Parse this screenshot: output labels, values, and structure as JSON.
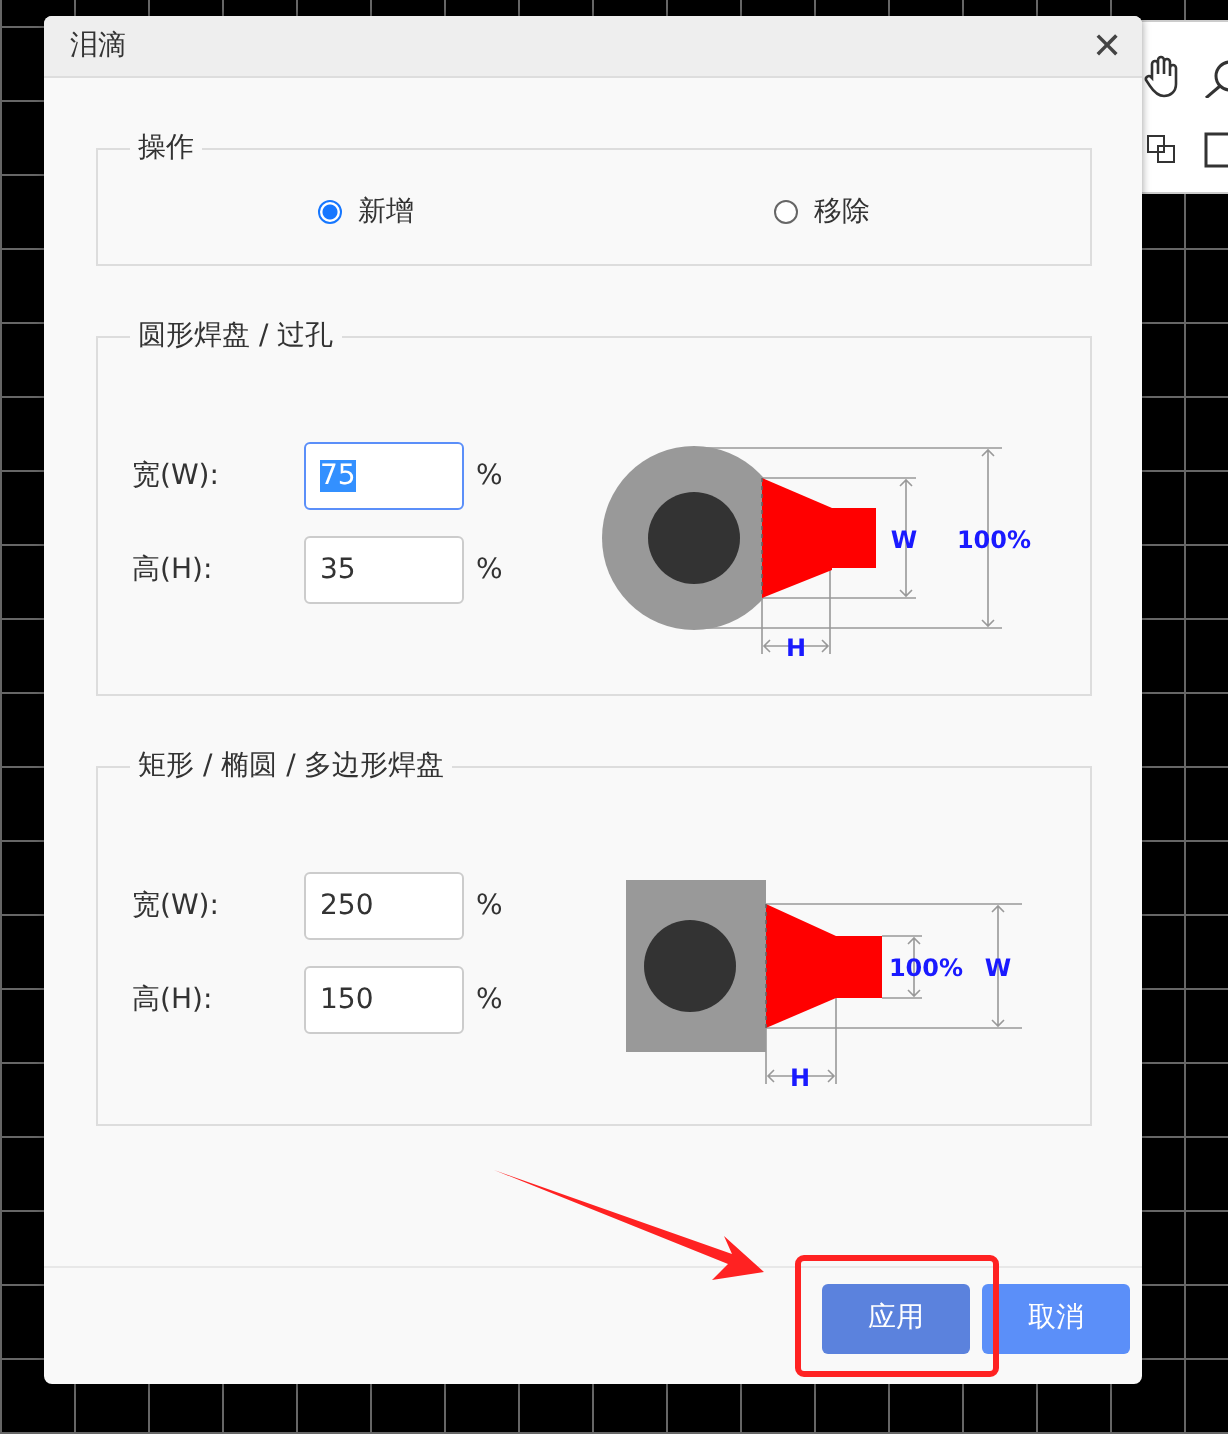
{
  "dialog": {
    "title": "泪滴",
    "close_icon": "✕"
  },
  "operation": {
    "legend": "操作",
    "options": [
      {
        "label": "新增",
        "selected": true
      },
      {
        "label": "移除",
        "selected": false
      }
    ]
  },
  "sections": [
    {
      "kind": "round",
      "legend": "圆形焊盘 / 过孔",
      "fields": [
        {
          "label": "宽(W):",
          "value": "75",
          "unit": "%",
          "focused": true
        },
        {
          "label": "高(H):",
          "value": "35",
          "unit": "%",
          "focused": false
        }
      ],
      "diagram_labels": {
        "w": "W",
        "full": "100%",
        "h": "H"
      }
    },
    {
      "kind": "rect",
      "legend": "矩形 / 椭圆 / 多边形焊盘",
      "fields": [
        {
          "label": "宽(W):",
          "value": "250",
          "unit": "%",
          "focused": false
        },
        {
          "label": "高(H):",
          "value": "150",
          "unit": "%",
          "focused": false
        }
      ],
      "diagram_labels": {
        "w": "W",
        "full": "100%",
        "h": "H"
      }
    }
  ],
  "buttons": [
    {
      "label": "应用",
      "kind": "primary"
    },
    {
      "label": "取消",
      "kind": "secondary"
    }
  ]
}
